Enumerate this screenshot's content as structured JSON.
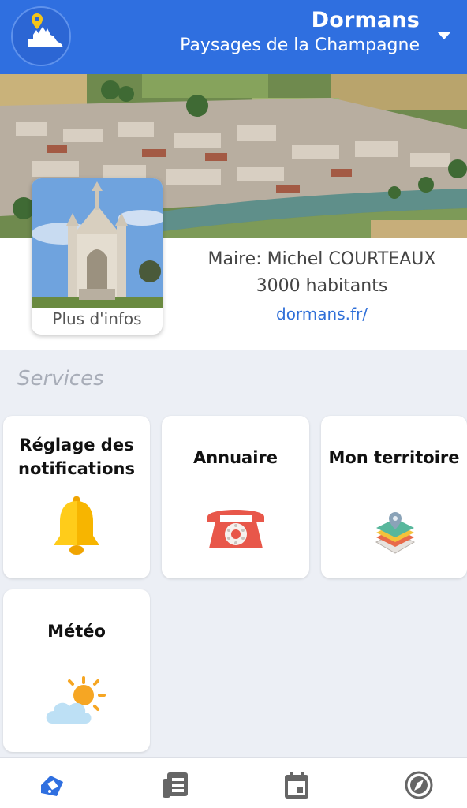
{
  "header": {
    "title": "Dormans",
    "subtitle": "Paysages de la Champagne"
  },
  "info": {
    "more_label": "Plus d'infos",
    "mayor": "Maire: Michel COURTEAUX",
    "population": "3000 habitants",
    "website": "dormans.fr/"
  },
  "services": {
    "title": "Services",
    "tiles": [
      {
        "label_line1": "Réglage des",
        "label_line2": "notifications",
        "icon": "bell-icon"
      },
      {
        "label": "Annuaire",
        "icon": "telephone-icon"
      },
      {
        "label": "Mon territoire",
        "icon": "map-layers-icon"
      },
      {
        "label": "Météo",
        "icon": "weather-icon"
      }
    ]
  },
  "nav": {
    "items": [
      "home-icon",
      "news-icon",
      "calendar-icon",
      "compass-icon"
    ],
    "active_color": "#2f6fe0",
    "inactive_color": "#666666"
  },
  "colors": {
    "brand": "#2f6fe0",
    "link": "#2f6fd8",
    "background": "#eceff5"
  }
}
